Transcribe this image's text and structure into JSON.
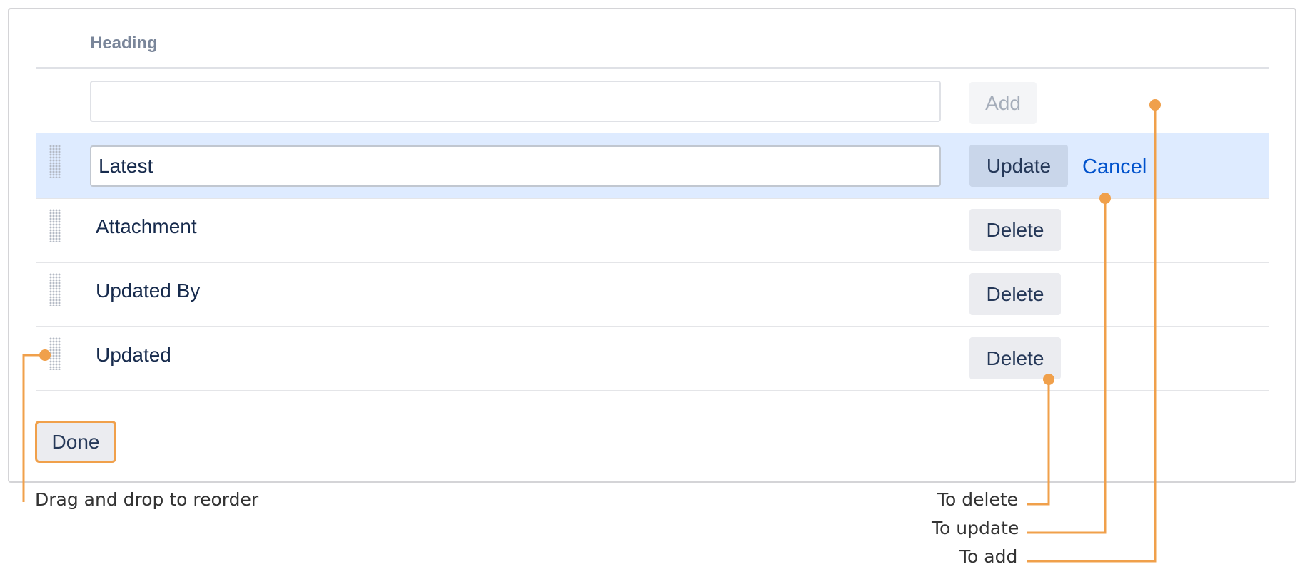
{
  "table": {
    "column_heading": "Heading",
    "new_row": {
      "input_value": "",
      "add_label": "Add"
    },
    "editing_row": {
      "input_value": "Latest",
      "update_label": "Update",
      "cancel_label": "Cancel"
    },
    "rows": [
      {
        "label": "Attachment",
        "delete_label": "Delete"
      },
      {
        "label": "Updated By",
        "delete_label": "Delete"
      },
      {
        "label": "Updated",
        "delete_label": "Delete"
      }
    ],
    "done_label": "Done"
  },
  "annotations": {
    "reorder": "Drag and drop to reorder",
    "delete": "To delete",
    "update": "To update",
    "add": "To add"
  },
  "colors": {
    "accent_callout": "#f0a04b",
    "editing_row_bg": "#deebff",
    "link": "#0052cc"
  },
  "icons": {
    "row_handle": "drag-handle-icon"
  }
}
